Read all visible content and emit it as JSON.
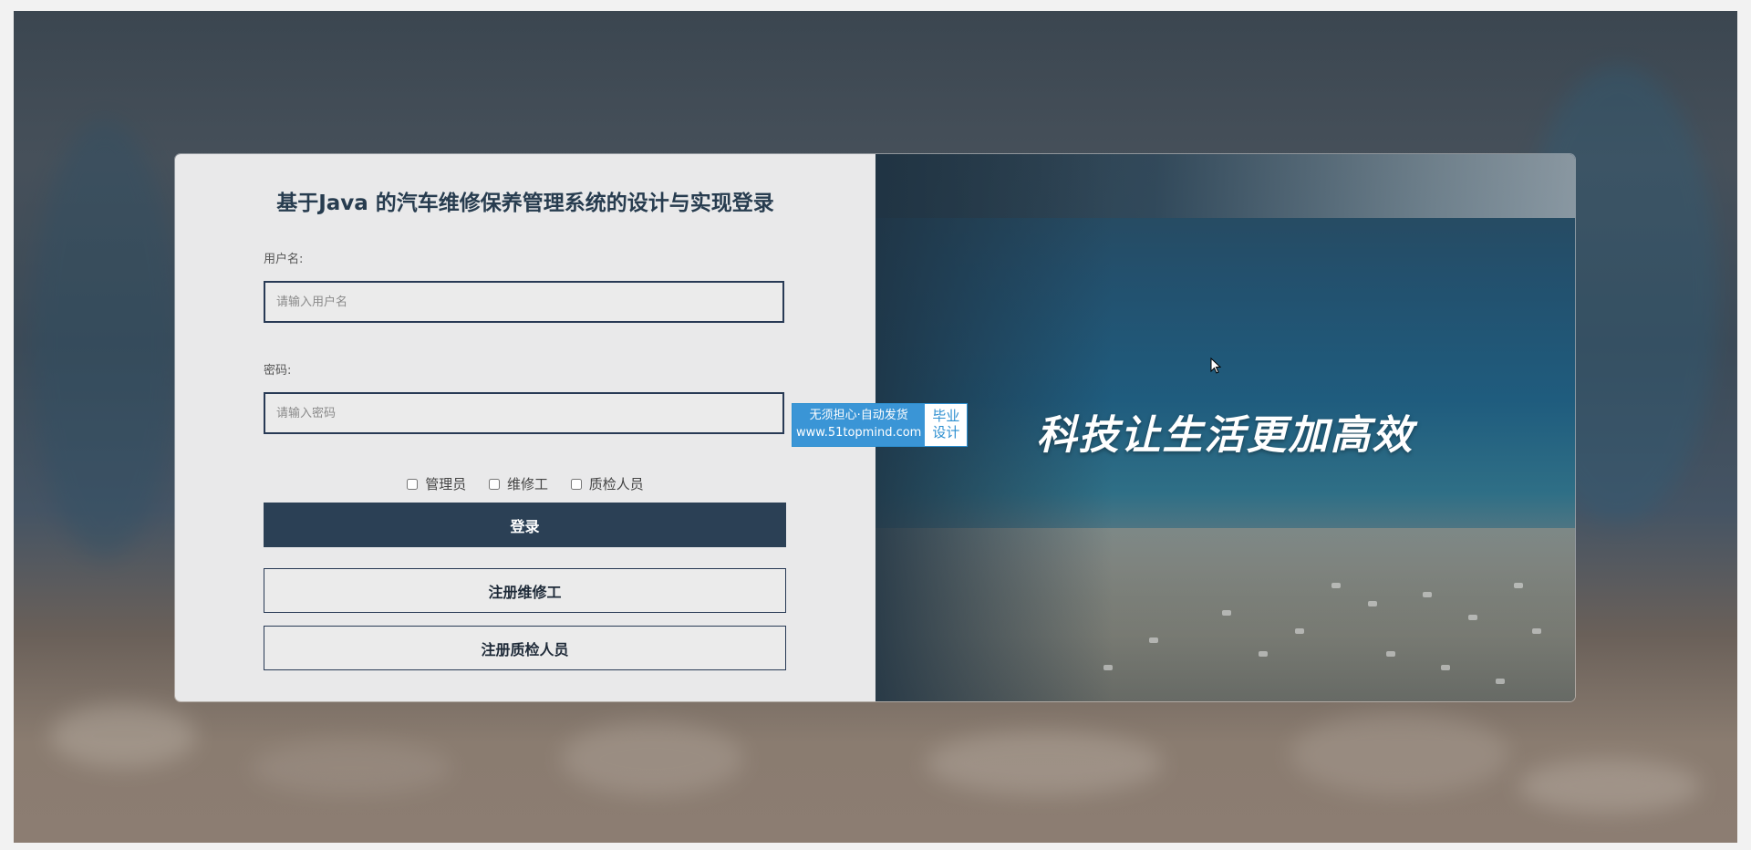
{
  "login": {
    "title": "基于Java 的汽车维修保养管理系统的设计与实现登录",
    "username": {
      "label": "用户名:",
      "placeholder": "请输入用户名",
      "value": ""
    },
    "password": {
      "label": "密码:",
      "placeholder": "请输入密码",
      "value": ""
    },
    "roles": [
      {
        "label": "管理员",
        "checked": false
      },
      {
        "label": "维修工",
        "checked": false
      },
      {
        "label": "质检人员",
        "checked": false
      }
    ],
    "buttons": {
      "login": "登录",
      "register_mechanic": "注册维修工",
      "register_inspector": "注册质检人员"
    }
  },
  "banner": {
    "slogan": "科技让生活更加高效"
  },
  "watermark": {
    "line1": "无须担心·自动发货",
    "line2": "www.51topmind.com",
    "badge_line1": "毕业",
    "badge_line2": "设计"
  },
  "colors": {
    "primary": "#2b4055",
    "title": "#273c4f",
    "panel": "#e9e9ea",
    "input_border": "#283a55",
    "watermark": "#3a95d6"
  }
}
